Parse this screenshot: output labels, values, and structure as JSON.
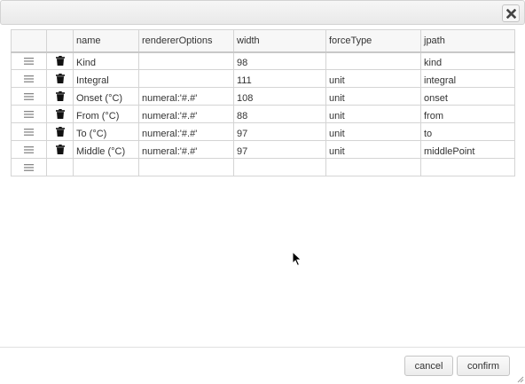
{
  "dialog": {
    "close_icon": "close-icon"
  },
  "table": {
    "columns": [
      "",
      "",
      "name",
      "rendererOptions",
      "width",
      "forceType",
      "jpath"
    ],
    "rows": [
      {
        "name": "Kind",
        "rendererOptions": "",
        "width": "98",
        "forceType": "",
        "jpath": "kind"
      },
      {
        "name": "Integral",
        "rendererOptions": "",
        "width": "111",
        "forceType": "unit",
        "jpath": "integral"
      },
      {
        "name": "Onset (°C)",
        "rendererOptions": "numeral:'#.#'",
        "width": "108",
        "forceType": "unit",
        "jpath": "onset"
      },
      {
        "name": "From (°C)",
        "rendererOptions": "numeral:'#.#'",
        "width": "88",
        "forceType": "unit",
        "jpath": "from"
      },
      {
        "name": "To (°C)",
        "rendererOptions": "numeral:'#.#'",
        "width": "97",
        "forceType": "unit",
        "jpath": "to"
      },
      {
        "name": "Middle (°C)",
        "rendererOptions": "numeral:'#.#'",
        "width": "97",
        "forceType": "unit",
        "jpath": "middlePoint"
      }
    ]
  },
  "footer": {
    "cancel_label": "cancel",
    "confirm_label": "confirm"
  }
}
